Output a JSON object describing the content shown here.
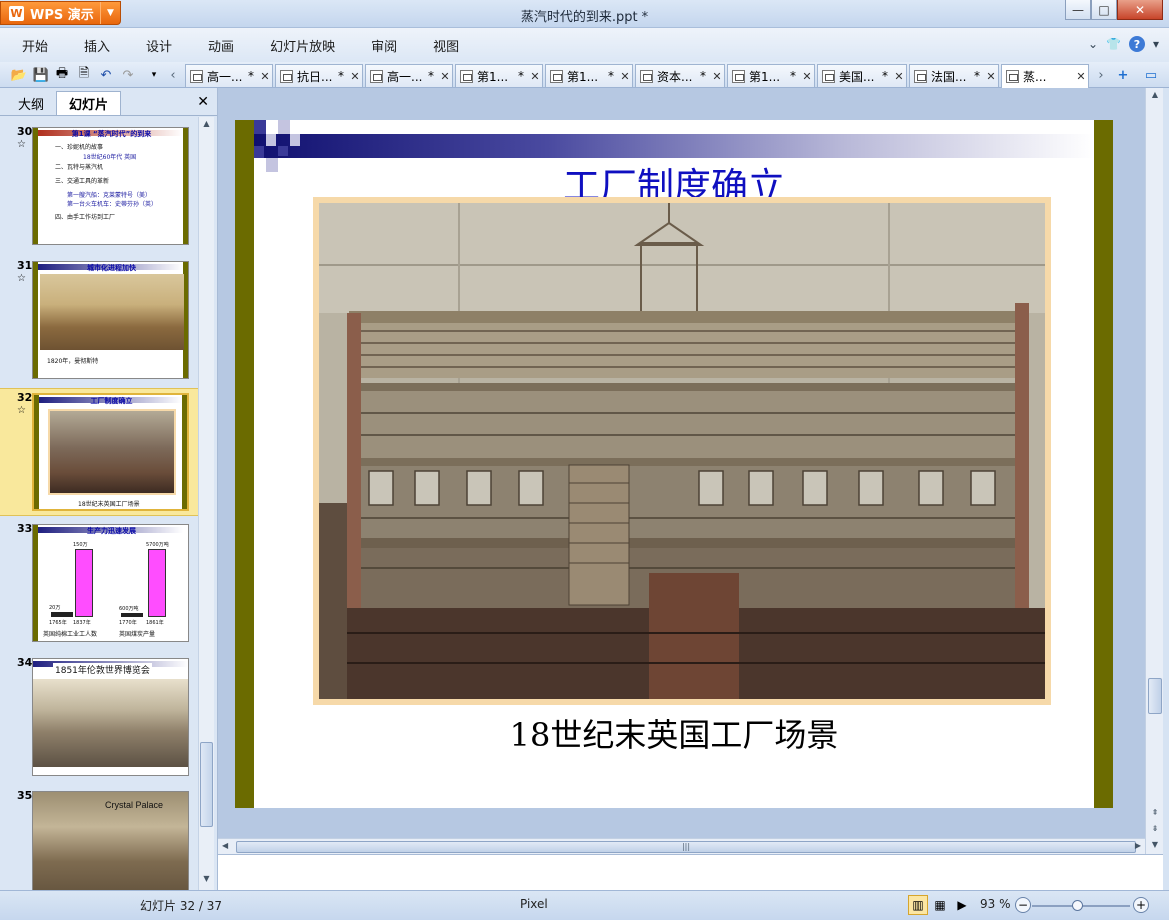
{
  "app": {
    "name": "WPS 演示",
    "logo": "W",
    "doc_title": "蒸汽时代的到来.ppt *"
  },
  "menu": [
    "开始",
    "插入",
    "设计",
    "动画",
    "幻灯片放映",
    "审阅",
    "视图"
  ],
  "doc_tabs": [
    {
      "label": "高一..."
    },
    {
      "label": "抗日..."
    },
    {
      "label": "高一..."
    },
    {
      "label": "第1..."
    },
    {
      "label": "第1..."
    },
    {
      "label": "资本..."
    },
    {
      "label": "第1..."
    },
    {
      "label": "美国..."
    },
    {
      "label": "法国..."
    },
    {
      "label": "蒸...",
      "active": true
    }
  ],
  "left_panel": {
    "tabs": [
      "大纲",
      "幻灯片"
    ],
    "active_tab": "幻灯片",
    "thumbnails": [
      {
        "number": "30",
        "title": "第1课 “蒸汽时代”的到来",
        "lines": [
          {
            "text": "一、珍妮机的故事",
            "blue": false
          },
          {
            "text": "18世纪60年代 英国",
            "blue": true
          },
          {
            "text": "二、瓦特与蒸汽机",
            "blue": false
          },
          {
            "text": "三、交通工具的革新",
            "blue": false
          },
          {
            "text": "第一艘汽船：克莱蒙特号（美）",
            "blue": true
          },
          {
            "text": "第一台火车机车：史蒂芬孙（英）",
            "blue": true
          },
          {
            "text": "四、由手工作坊到工厂",
            "blue": false
          }
        ]
      },
      {
        "number": "31",
        "title": "城市化进程加快",
        "caption": "1820年，曼彻斯特"
      },
      {
        "number": "32",
        "title": "工厂制度确立",
        "caption": "18世纪末英国工厂场景"
      },
      {
        "number": "33",
        "title": "生产力迅速发展",
        "bars": [
          {
            "label": "英国纯棉工业工人数",
            "low_label": "1765年",
            "high_label": "1837年",
            "low_value": "20万",
            "high_value": "150万"
          },
          {
            "label": "英国煤炭产量",
            "low_label": "1770年",
            "high_label": "1861年",
            "low_value": "600万吨",
            "high_value": "5700万吨"
          }
        ]
      },
      {
        "number": "34",
        "title": "1851年伦敦世界博览会"
      },
      {
        "number": "35",
        "title": "Crystal Palace"
      }
    ]
  },
  "slide": {
    "title": "工厂制度确立",
    "caption": "18世纪末英国工厂场景"
  },
  "status": {
    "slide_counter": "幻灯片 32 / 37",
    "theme": "Pixel",
    "zoom": "93 %"
  },
  "colors": {
    "olive_frame": "#6b6b00",
    "title_blue": "#0f0fc0",
    "selected_thumb": "#f9e89c",
    "app_orange": "#e8660d"
  }
}
